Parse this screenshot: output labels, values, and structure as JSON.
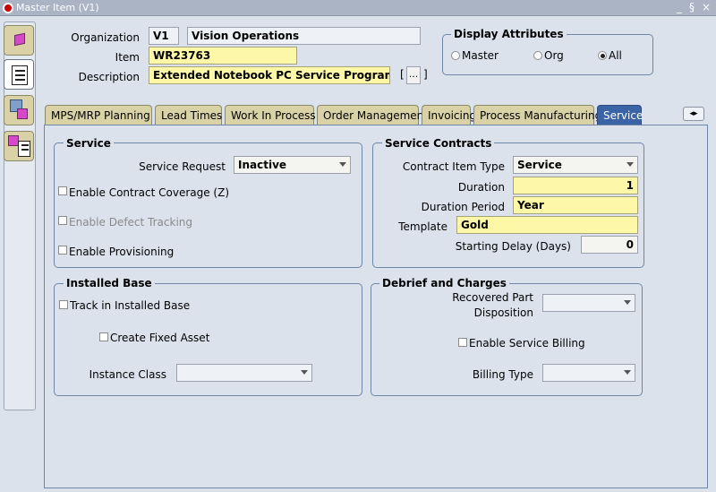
{
  "window": {
    "title": "Master Item (V1)",
    "controls": [
      "_",
      "§",
      "×"
    ]
  },
  "header": {
    "organization_label": "Organization",
    "organization_code": "V1",
    "organization_name": "Vision Operations",
    "item_label": "Item",
    "item_value": "WR23763",
    "description_label": "Description",
    "description_value": "Extended Notebook PC Service Program (Gol",
    "desc_bracket_open": "[",
    "desc_bracket_close": "]",
    "desc_button_label": "..."
  },
  "display_attributes": {
    "title": "Display Attributes",
    "options": [
      {
        "label": "Master",
        "selected": false
      },
      {
        "label": "Org",
        "selected": false
      },
      {
        "label": "All",
        "selected": true
      }
    ]
  },
  "tabs": [
    {
      "label": "MPS/MRP Planning",
      "active": false
    },
    {
      "label": "Lead Times",
      "active": false
    },
    {
      "label": "Work In Process",
      "active": false
    },
    {
      "label": "Order Management",
      "active": false
    },
    {
      "label": "Invoicing",
      "active": false
    },
    {
      "label": "Process Manufacturing",
      "active": false
    },
    {
      "label": "Service",
      "active": true
    }
  ],
  "tab_scroll_label": "◂▸",
  "service": {
    "title": "Service",
    "service_request_label": "Service Request",
    "service_request_value": "Inactive",
    "enable_contract_coverage": "Enable Contract Coverage (Z)",
    "enable_defect_tracking": "Enable Defect Tracking",
    "enable_provisioning": "Enable Provisioning"
  },
  "service_contracts": {
    "title": "Service Contracts",
    "contract_item_type_label": "Contract Item Type",
    "contract_item_type_value": "Service",
    "duration_label": "Duration",
    "duration_value": "1",
    "duration_period_label": "Duration Period",
    "duration_period_value": "Year",
    "template_label": "Template",
    "template_value": "Gold",
    "starting_delay_label": "Starting Delay (Days)",
    "starting_delay_value": "0"
  },
  "installed_base": {
    "title": "Installed Base",
    "track_label": "Track in Installed Base",
    "create_fixed_asset_label": "Create Fixed Asset",
    "instance_class_label": "Instance Class",
    "instance_class_value": ""
  },
  "debrief": {
    "title": "Debrief and Charges",
    "recovered_part_label_1": "Recovered Part",
    "recovered_part_label_2": "Disposition",
    "recovered_part_value": "",
    "enable_service_billing": "Enable Service Billing",
    "billing_type_label": "Billing Type",
    "billing_type_value": ""
  },
  "colors": {
    "background": "#dbe2ec",
    "required_field": "#fdf7a8",
    "active_tab": "#3a64a6",
    "inactive_tab": "#d8d2a6"
  }
}
